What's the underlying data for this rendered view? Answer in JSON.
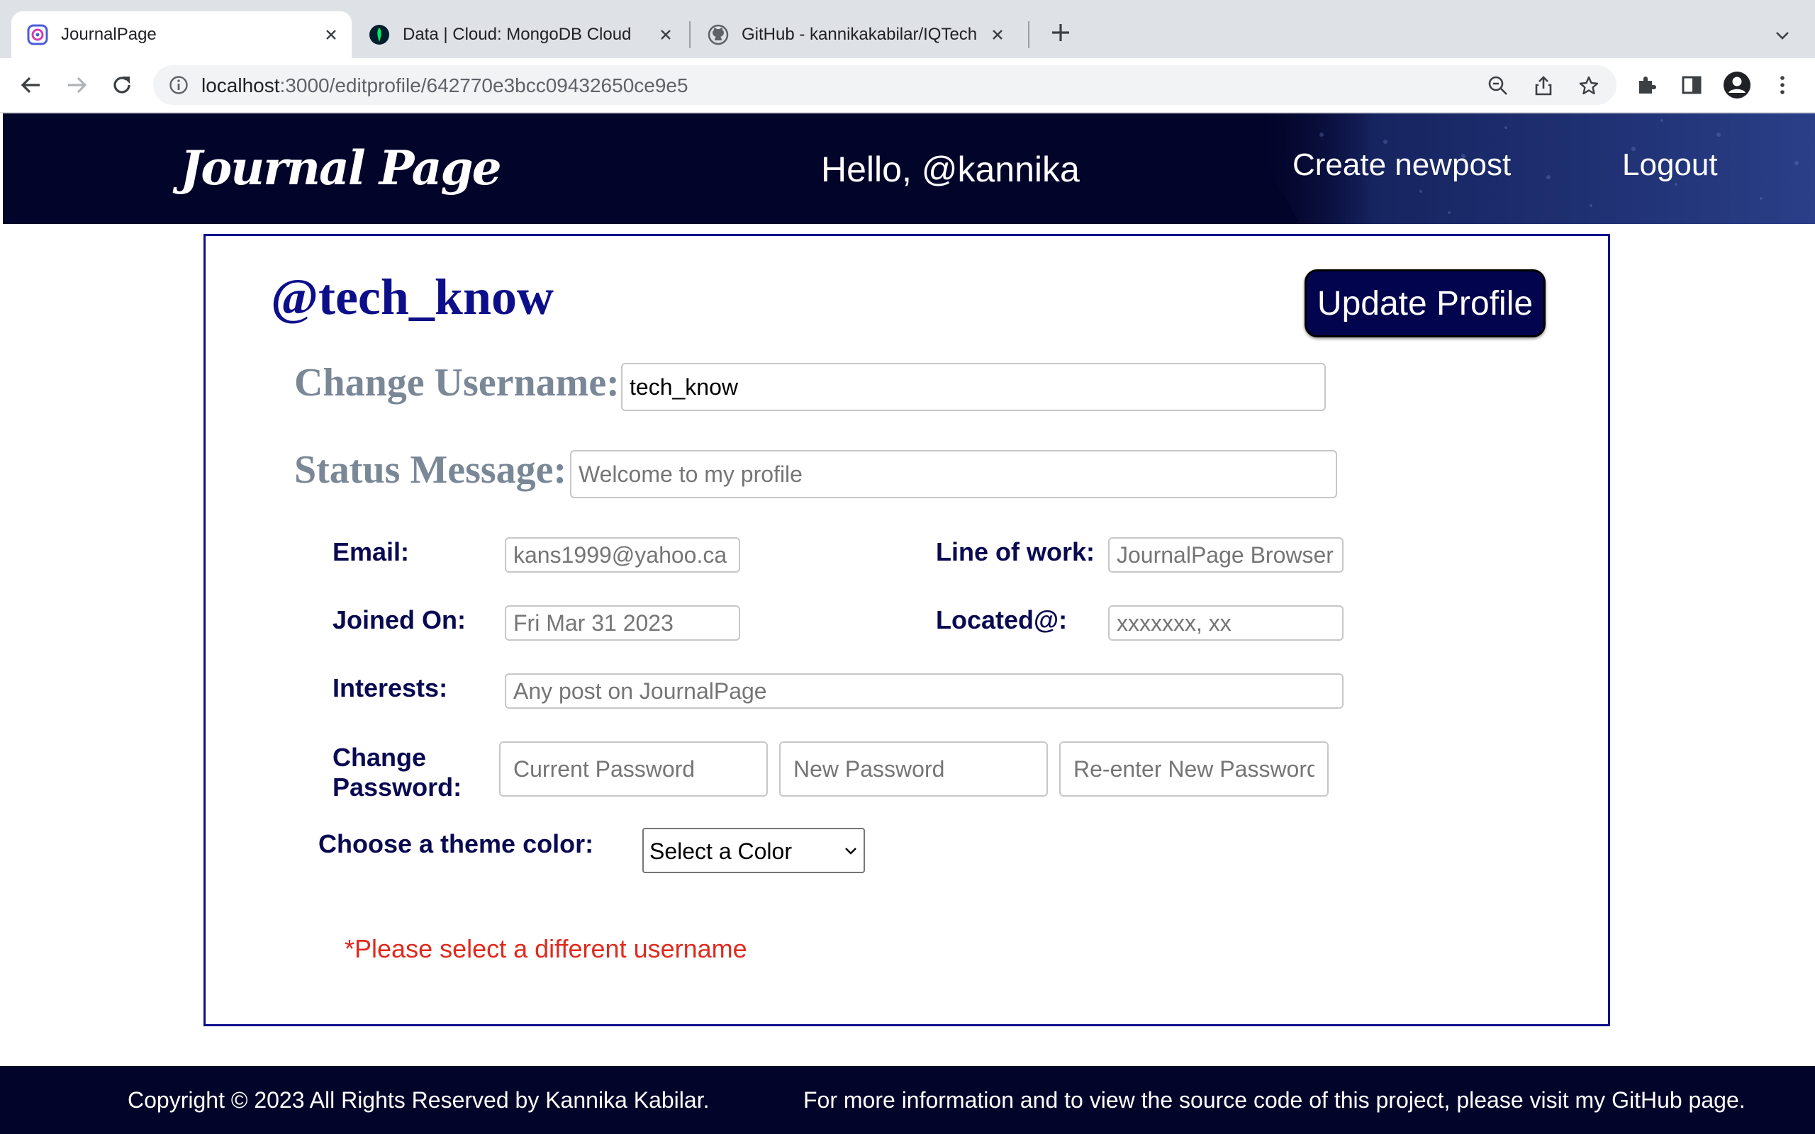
{
  "browser": {
    "tabs": [
      {
        "title": "JournalPage",
        "active": true,
        "icon": "journalpage-favicon"
      },
      {
        "title": "Data | Cloud: MongoDB Cloud",
        "active": false,
        "icon": "mongodb-leaf-icon"
      },
      {
        "title": "GitHub - kannikakabilar/IQTech",
        "active": false,
        "icon": "github-icon"
      }
    ],
    "url_host": "localhost",
    "url_path": ":3000/editprofile/642770e3bcc09432650ce9e5"
  },
  "header": {
    "brand": "Journal Page",
    "greeting": "Hello, @kannika",
    "nav": {
      "create": "Create newpost",
      "logout": "Logout"
    }
  },
  "profile": {
    "handle": "@tech_know",
    "update_button": "Update Profile",
    "username": {
      "label": "Change Username:",
      "value": "tech_know"
    },
    "status": {
      "label": "Status Message:",
      "placeholder": "Welcome to my profile"
    },
    "email": {
      "label": "Email:",
      "placeholder": "kans1999@yahoo.ca"
    },
    "line_of_work": {
      "label": "Line of work:",
      "placeholder": "JournalPage Browser"
    },
    "joined": {
      "label": "Joined On:",
      "placeholder": "Fri Mar 31 2023"
    },
    "located": {
      "label": "Located@:",
      "placeholder": "xxxxxxx, xx"
    },
    "interests": {
      "label": "Interests:",
      "placeholder": "Any post on JournalPage"
    },
    "password": {
      "label_line1": "Change",
      "label_line2": "Password:",
      "current_placeholder": "Current Password",
      "new_placeholder": "New Password",
      "reenter_placeholder": "Re-enter New Password"
    },
    "theme": {
      "label": "Choose a theme color:",
      "selected": "Select a Color"
    },
    "error": "*Please select a different username"
  },
  "footer": {
    "copyright": "Copyright © 2023 All Rights Reserved by Kannika Kabilar.",
    "info": "For more information and to view the source code of this project, please visit my GitHub page."
  },
  "colors": {
    "header_bg": "#03042a",
    "accent_blue": "#0d0f8a",
    "button_bg": "#03044e",
    "label_gray": "#7a8797",
    "error_red": "#e02a1e"
  }
}
